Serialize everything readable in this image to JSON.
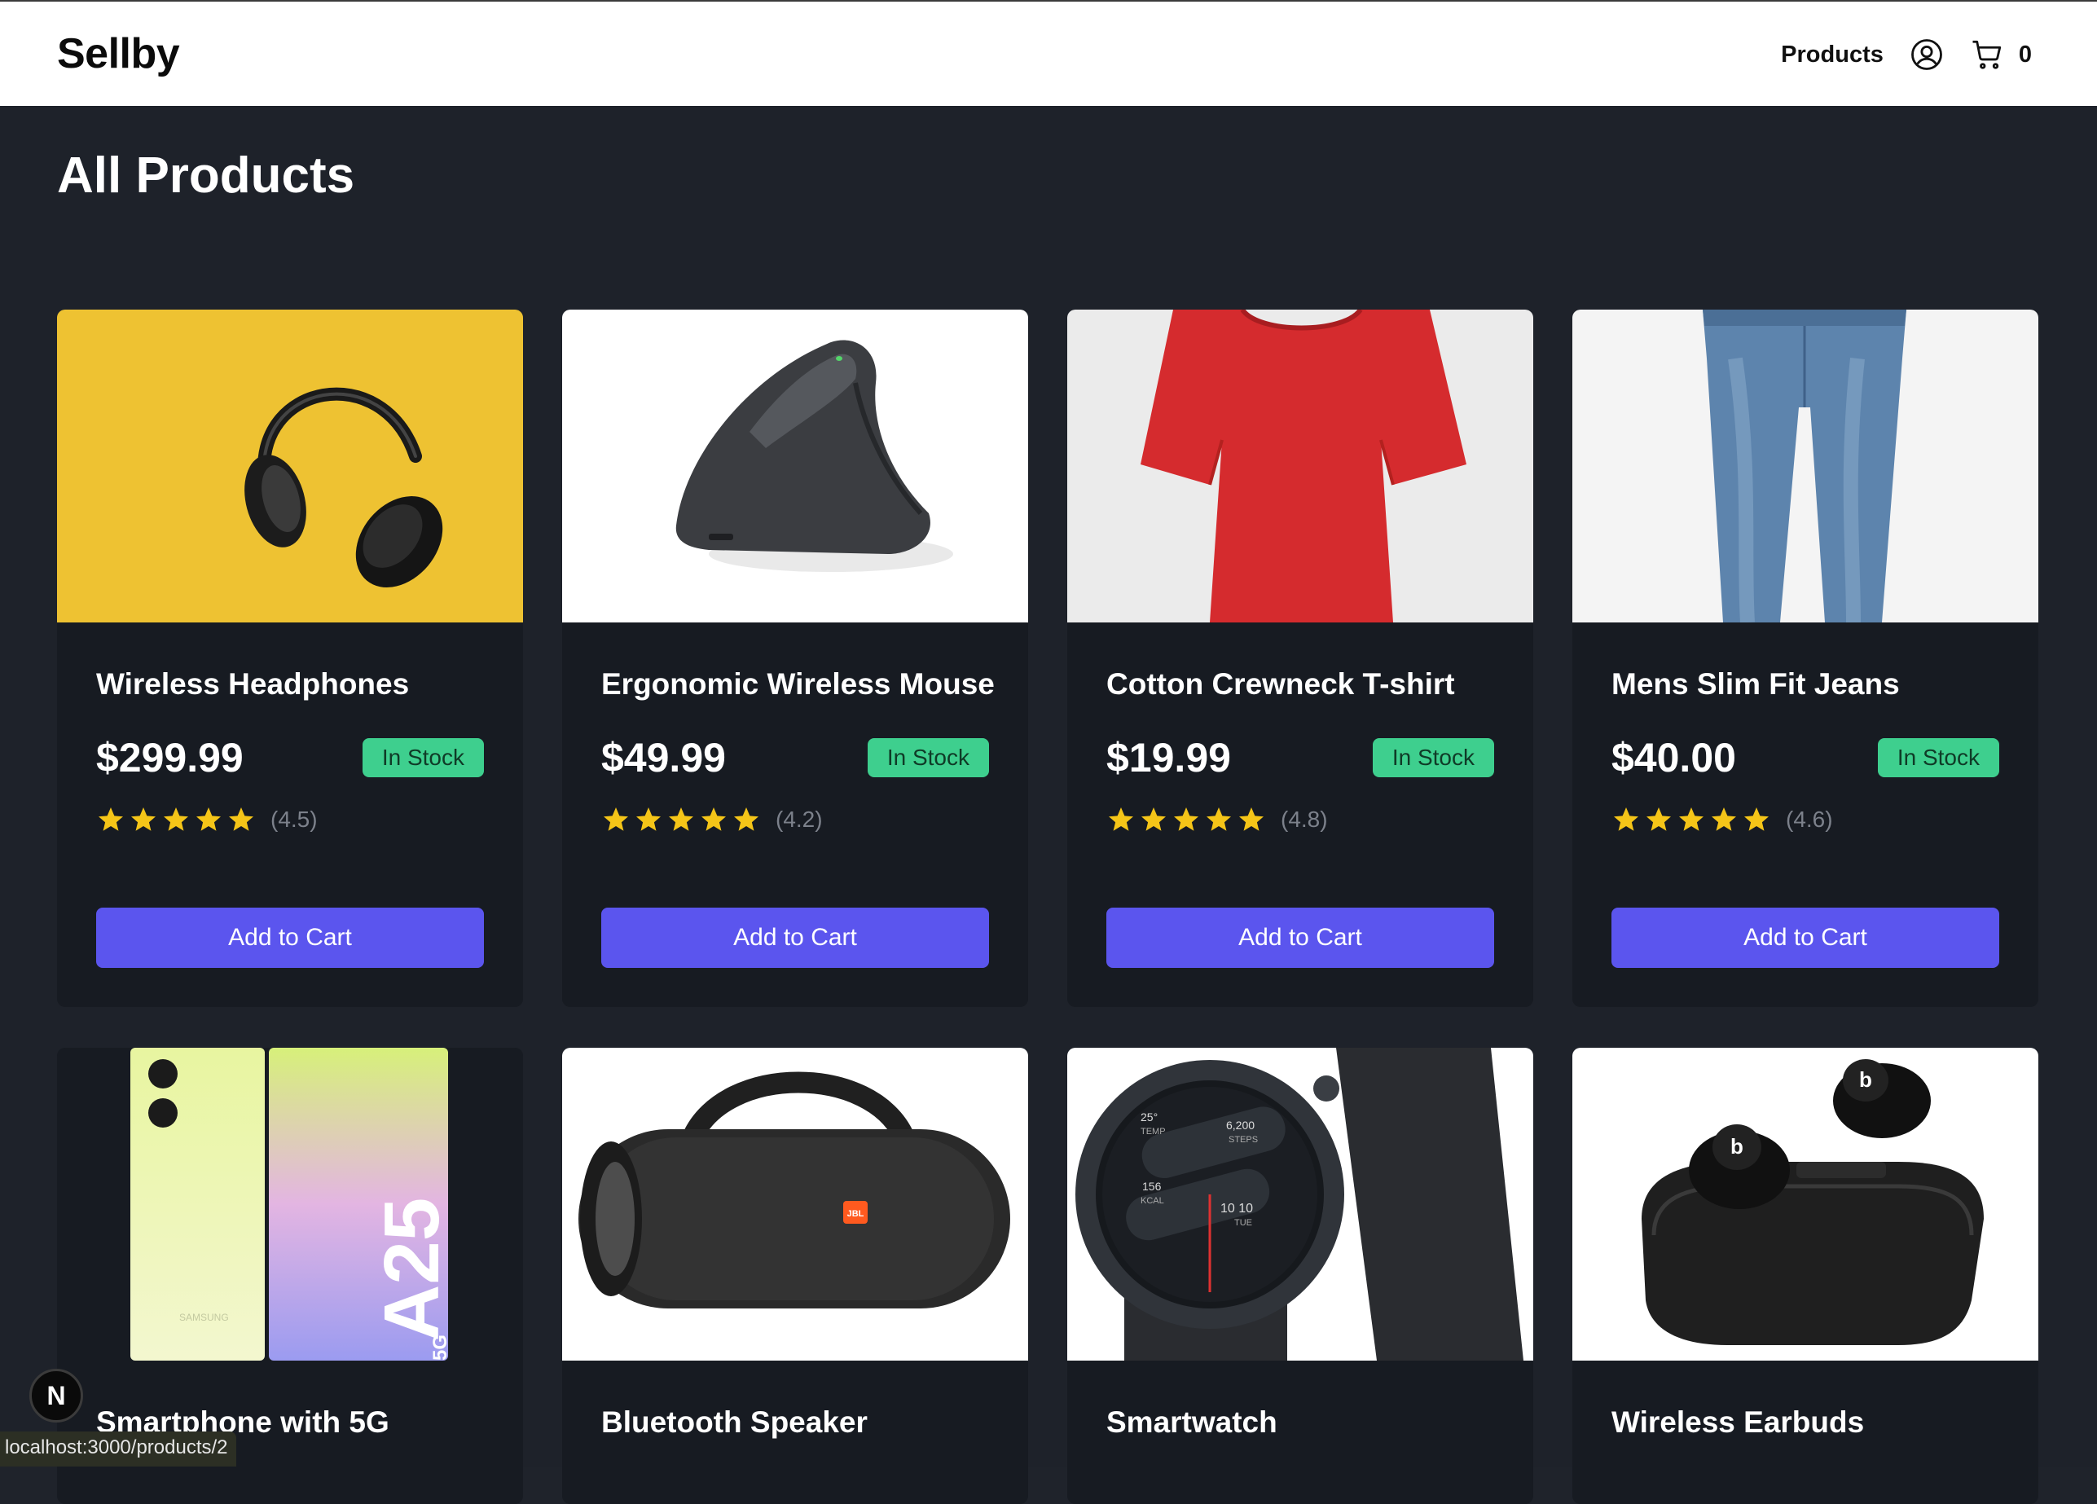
{
  "header": {
    "brand": "Sellby",
    "nav_products": "Products",
    "cart_count": "0",
    "user_icon": "user-circle-icon",
    "cart_icon": "shopping-cart-icon"
  },
  "main": {
    "title": "All Products"
  },
  "products": [
    {
      "name": "Wireless Headphones",
      "price": "$299.99",
      "stock": "In Stock",
      "rating": "(4.5)",
      "cta": "Add to Cart"
    },
    {
      "name": "Ergonomic Wireless Mouse",
      "price": "$49.99",
      "stock": "In Stock",
      "rating": "(4.2)",
      "cta": "Add to Cart"
    },
    {
      "name": "Cotton Crewneck T-shirt",
      "price": "$19.99",
      "stock": "In Stock",
      "rating": "(4.8)",
      "cta": "Add to Cart"
    },
    {
      "name": "Mens Slim Fit Jeans",
      "price": "$40.00",
      "stock": "In Stock",
      "rating": "(4.6)",
      "cta": "Add to Cart"
    },
    {
      "name": "Smartphone with 5G"
    },
    {
      "name": "Bluetooth Speaker"
    },
    {
      "name": "Smartwatch"
    },
    {
      "name": "Wireless Earbuds"
    }
  ],
  "image_text": {
    "phone_model": "A25",
    "phone_brand": "SAMSUNG",
    "phone_5g": "5G",
    "speaker_brand": "JBL",
    "watch_temp": "25°",
    "watch_temp_label": "TEMP",
    "watch_steps": "6,200",
    "watch_steps_label": "STEPS",
    "watch_kcal": "156",
    "watch_kcal_label": "KCAL",
    "watch_date": "10 10",
    "watch_day": "TUE"
  },
  "status_bar": {
    "url": "localhost:3000/products/2"
  },
  "dev_badge": {
    "label": "N"
  },
  "colors": {
    "accent": "#5b55ee",
    "badge": "#3ecf8e",
    "star": "#f5c518",
    "background": "#1e222a",
    "card": "#171b22"
  }
}
